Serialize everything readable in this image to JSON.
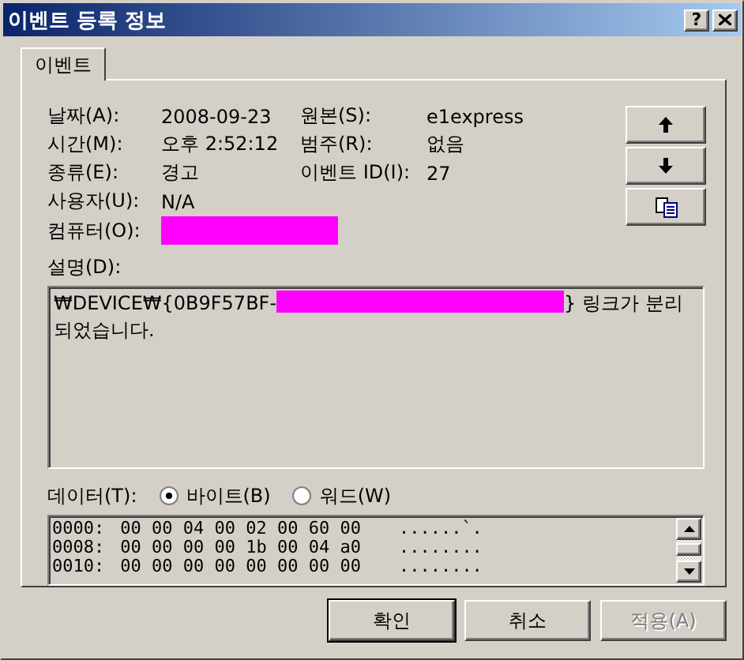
{
  "window": {
    "title": "이벤트 등록 정보",
    "help_button": "?"
  },
  "tabs": [
    {
      "label": "이벤트",
      "selected": true
    }
  ],
  "properties": [
    {
      "cells": [
        {
          "label": "날짜(A):",
          "value": "2008-09-23",
          "kind": "text"
        },
        {
          "label": "원본(S):",
          "value": "e1express",
          "kind": "text"
        }
      ]
    },
    {
      "cells": [
        {
          "label": "시간(M):",
          "value": "오후 2:52:12",
          "kind": "text"
        },
        {
          "label": "범주(R):",
          "value": "없음",
          "kind": "text"
        }
      ]
    },
    {
      "cells": [
        {
          "label": "종류(E):",
          "value": "경고",
          "kind": "text"
        },
        {
          "label": "이벤트 ID(I):",
          "value": "27",
          "kind": "text"
        }
      ]
    },
    {
      "cells": [
        {
          "label": "사용자(U):",
          "value": "N/A",
          "kind": "text"
        }
      ]
    },
    {
      "cells": [
        {
          "label": "컴퓨터(O):",
          "kind": "redacted"
        }
      ]
    }
  ],
  "side_buttons": [
    {
      "kind": "up"
    },
    {
      "kind": "down"
    },
    {
      "kind": "copy"
    }
  ],
  "description": {
    "label": "설명(D):",
    "before": "₩DEVICE₩{0B9F57BF-",
    "after": "} 링크가 분리되었습니다."
  },
  "data": {
    "label": "데이터(T):",
    "options": [
      {
        "label": "바이트(B)",
        "selected": true
      },
      {
        "label": "워드(W)",
        "selected": false
      }
    ],
    "rows": [
      {
        "offset": "0000:",
        "bytes": "00 00 04 00 02 00 60 00",
        "chars": "......`."
      },
      {
        "offset": "0008:",
        "bytes": "00 00 00 00 1b 00 04 a0",
        "chars": "........"
      },
      {
        "offset": "0010:",
        "bytes": "00 00 00 00 00 00 00 00",
        "chars": "........"
      }
    ]
  },
  "buttons": [
    {
      "label": "확인",
      "disabled": false,
      "default": true
    },
    {
      "label": "취소",
      "disabled": false,
      "default": false
    },
    {
      "label": "적용(A)",
      "disabled": true,
      "default": false
    }
  ]
}
